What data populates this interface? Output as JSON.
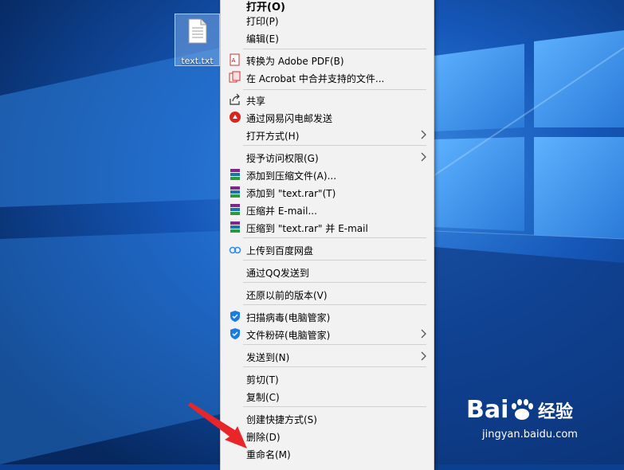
{
  "desktop": {
    "file_label": "text.txt"
  },
  "menu": {
    "open": "打开(O)",
    "print": "打印(P)",
    "edit": "编辑(E)",
    "convert_pdf": "转换为 Adobe PDF(B)",
    "acrobat_merge": "在 Acrobat 中合并支持的文件...",
    "share": "共享",
    "netease_send": "通过网易闪电邮发送",
    "open_with": "打开方式(H)",
    "grant_access": "授予访问权限(G)",
    "add_archive": "添加到压缩文件(A)...",
    "add_rar": "添加到 \"text.rar\"(T)",
    "compress_email": "压缩并 E-mail...",
    "compress_rar_email": "压缩到 \"text.rar\" 并 E-mail",
    "baidu_upload": "上传到百度网盘",
    "qq_send": "通过QQ发送到",
    "restore": "还原以前的版本(V)",
    "scan_virus": "扫描病毒(电脑管家)",
    "shred": "文件粉碎(电脑管家)",
    "send_to": "发送到(N)",
    "cut": "剪切(T)",
    "copy": "复制(C)",
    "create_shortcut": "创建快捷方式(S)",
    "delete": "删除(D)",
    "rename": "重命名(M)"
  },
  "watermark": {
    "brand": "Bai",
    "brand_suffix": "经验",
    "url": "jingyan.baidu.com"
  },
  "colors": {
    "desktop_bg": "#0b3f8f",
    "annotation": "#e8262a"
  }
}
